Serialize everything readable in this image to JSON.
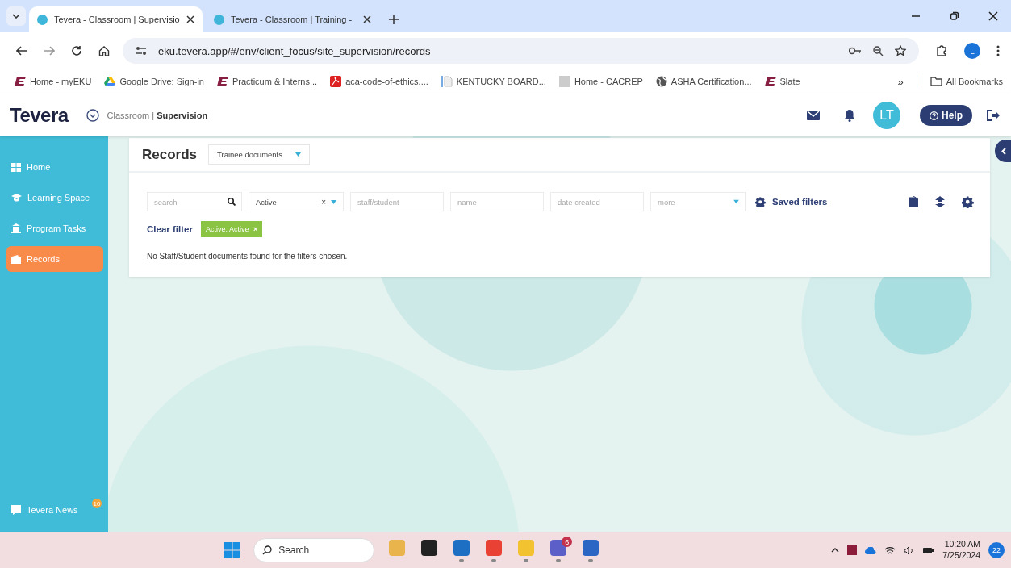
{
  "browser": {
    "tabs": [
      {
        "title": "Tevera - Classroom | Supervisio",
        "selected": true
      },
      {
        "title": "Tevera - Classroom | Training -",
        "selected": false
      }
    ],
    "address": "eku.tevera.app/#/env/client_focus/site_supervision/records",
    "profile": "L",
    "bookmarks": [
      {
        "label": "Home - myEKU",
        "kind": "eku"
      },
      {
        "label": "Google Drive: Sign-in",
        "kind": "drive"
      },
      {
        "label": "Practicum & Interns...",
        "kind": "eku"
      },
      {
        "label": "aca-code-of-ethics....",
        "kind": "pdf"
      },
      {
        "label": "KENTUCKY BOARD...",
        "kind": "doc"
      },
      {
        "label": "Home - CACREP",
        "kind": "page"
      },
      {
        "label": "ASHA Certification...",
        "kind": "globe"
      },
      {
        "label": "Slate",
        "kind": "eku"
      }
    ],
    "overflow": "»",
    "all_bookmarks": "All Bookmarks"
  },
  "app": {
    "logo": "Tevera",
    "course": "Classroom",
    "separator": "|",
    "section": "Supervision",
    "avatar": "LT",
    "help": "Help"
  },
  "sidebar": {
    "items": [
      {
        "label": "Home",
        "kind": "grid",
        "selected": false
      },
      {
        "label": "Learning Space",
        "kind": "cap",
        "selected": false
      },
      {
        "label": "Program Tasks",
        "kind": "building",
        "selected": false
      },
      {
        "label": "Records",
        "kind": "folder",
        "selected": true
      }
    ],
    "news": {
      "label": "Tevera News",
      "badge": "10"
    }
  },
  "records": {
    "title": "Records",
    "doc_type": "Trainee documents",
    "filters": {
      "search": {
        "placeholder": "search"
      },
      "status": {
        "value": "Active",
        "clear": "×"
      },
      "fields": [
        {
          "placeholder": "staff/student"
        },
        {
          "placeholder": "name"
        },
        {
          "placeholder": "date created"
        }
      ],
      "more": {
        "placeholder": "more"
      },
      "saved_filters": "Saved filters"
    },
    "clear_filter": "Clear filter",
    "chips": [
      {
        "label": "Active: Active",
        "remove": "×"
      }
    ],
    "message": "No Staff/Student documents found for the filters chosen."
  },
  "taskbar": {
    "search": {
      "placeholder": "Search"
    },
    "apps": [
      {
        "kind": "widget",
        "running": false
      },
      {
        "kind": "files",
        "running": false
      },
      {
        "kind": "outlook",
        "running": true
      },
      {
        "kind": "chrome",
        "running": true
      },
      {
        "kind": "explorer",
        "running": true
      },
      {
        "kind": "teams",
        "running": true,
        "badge": "6"
      },
      {
        "kind": "word",
        "running": true
      }
    ],
    "time": "10:20 AM",
    "date": "7/25/2024",
    "notifications": "22"
  }
}
